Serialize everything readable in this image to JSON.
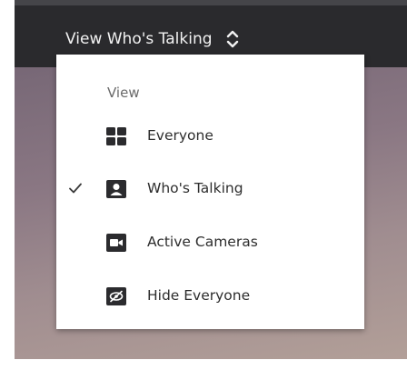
{
  "toolbar": {
    "view_selector_label": "View Who's Talking",
    "view_selector_icon": "up-down-chevron-icon"
  },
  "menu": {
    "heading": "View",
    "items": [
      {
        "label": "Everyone",
        "icon": "grid-icon",
        "checked": false
      },
      {
        "label": "Who's Talking",
        "icon": "speaker-person-icon",
        "checked": true
      },
      {
        "label": "Active Cameras",
        "icon": "camera-icon",
        "checked": false
      },
      {
        "label": "Hide Everyone",
        "icon": "hide-icon",
        "checked": false
      }
    ]
  },
  "colors": {
    "topbar": "#2a2a2d",
    "menu_bg": "#ffffff",
    "icon": "#2b2b2e",
    "text": "#2d2d2d"
  }
}
